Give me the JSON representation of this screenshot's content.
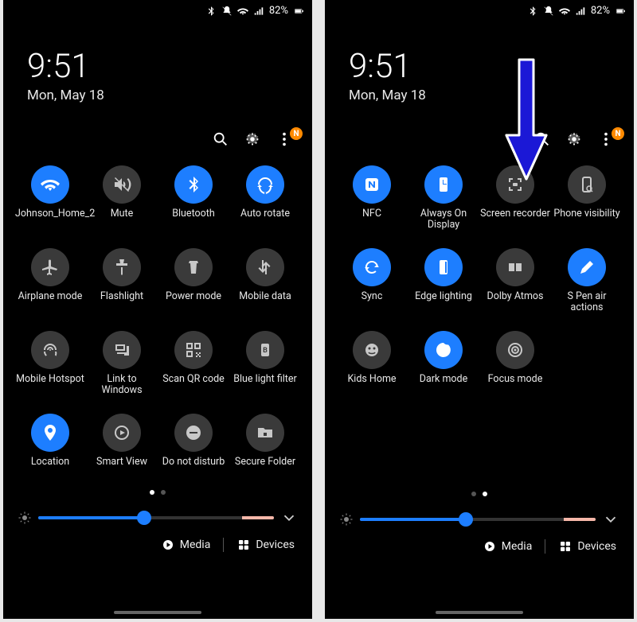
{
  "status": {
    "battery_percent": "82%"
  },
  "time": "9:51",
  "date": "Mon, May 18",
  "badge_label": "N",
  "panel1": {
    "tiles": [
      {
        "key": "wifi",
        "label": "Johnson_Home_2",
        "active": true
      },
      {
        "key": "mute",
        "label": "Mute",
        "active": false
      },
      {
        "key": "bluetooth",
        "label": "Bluetooth",
        "active": true
      },
      {
        "key": "autorotate",
        "label": "Auto rotate",
        "active": true
      },
      {
        "key": "airplane",
        "label": "Airplane mode",
        "active": false
      },
      {
        "key": "flashlight",
        "label": "Flashlight",
        "active": false
      },
      {
        "key": "powermode",
        "label": "Power mode",
        "active": false
      },
      {
        "key": "mobiledata",
        "label": "Mobile data",
        "active": false
      },
      {
        "key": "hotspot",
        "label": "Mobile Hotspot",
        "active": false
      },
      {
        "key": "linkwin",
        "label": "Link to Windows",
        "active": false
      },
      {
        "key": "qrcode",
        "label": "Scan QR code",
        "active": false
      },
      {
        "key": "bluelight",
        "label": "Blue light filter",
        "active": false
      },
      {
        "key": "location",
        "label": "Location",
        "active": true
      },
      {
        "key": "smartview",
        "label": "Smart View",
        "active": false
      },
      {
        "key": "dnd",
        "label": "Do not disturb",
        "active": false
      },
      {
        "key": "securefolder",
        "label": "Secure Folder",
        "active": false
      }
    ],
    "page_active": 0
  },
  "panel2": {
    "tiles": [
      {
        "key": "nfc",
        "label": "NFC",
        "active": true
      },
      {
        "key": "aod",
        "label": "Always On Display",
        "active": true
      },
      {
        "key": "screenrec",
        "label": "Screen recorder",
        "active": false
      },
      {
        "key": "phonevis",
        "label": "Phone visibility",
        "active": false
      },
      {
        "key": "sync",
        "label": "Sync",
        "active": true
      },
      {
        "key": "edgelight",
        "label": "Edge lighting",
        "active": true
      },
      {
        "key": "dolby",
        "label": "Dolby Atmos",
        "active": false
      },
      {
        "key": "spen",
        "label": "S Pen air actions",
        "active": true
      },
      {
        "key": "kidshome",
        "label": "Kids Home",
        "active": false
      },
      {
        "key": "darkmode",
        "label": "Dark mode",
        "active": true
      },
      {
        "key": "focusmode",
        "label": "Focus mode",
        "active": false
      }
    ],
    "page_active": 1
  },
  "brightness": {
    "percent": 45
  },
  "bottom": {
    "media": "Media",
    "devices": "Devices"
  }
}
